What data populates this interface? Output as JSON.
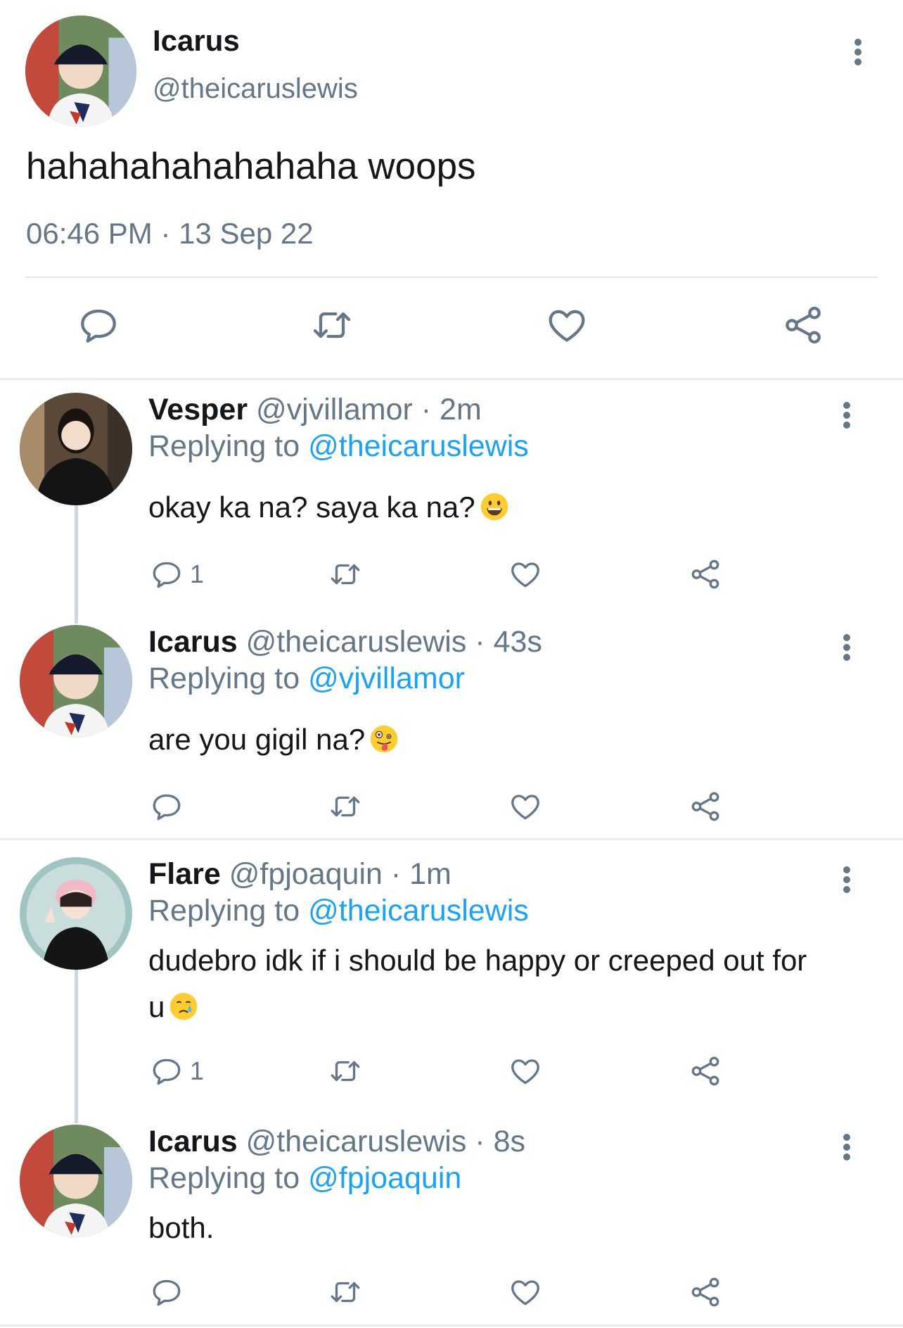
{
  "colors": {
    "text": "#14171a",
    "muted": "#657786",
    "link": "#1da1f2",
    "divider": "#e1e8ed",
    "thread_line": "#ccd6dd"
  },
  "main_tweet": {
    "name": "Icarus",
    "handle": "@theicaruslewis",
    "text": "hahahahahahahaha woops",
    "timestamp": "06:46 PM · 13 Sep 22",
    "actions": [
      "reply-icon",
      "retweet-icon",
      "like-icon",
      "share-icon"
    ]
  },
  "replies": [
    {
      "name": "Vesper",
      "meta": "@vjvillamor · 2m",
      "replying_label": "Replying to",
      "replying_to": "@theicaruslewis",
      "text": "okay ka na? saya ka na?",
      "emoji": "grinning-face-emoji",
      "reply_count": "1"
    },
    {
      "name": "Icarus",
      "meta": "@theicaruslewis · 43s",
      "replying_label": "Replying to",
      "replying_to": "@vjvillamor",
      "text": "are you gigil na?",
      "emoji": "zany-face-emoji",
      "reply_count": ""
    },
    {
      "name": "Flare",
      "meta": "@fpjoaquin · 1m",
      "replying_label": "Replying to",
      "replying_to": "@theicaruslewis",
      "text": "dudebro idk if i should be happy or creeped out for u",
      "emoji": "crying-face-emoji",
      "reply_count": "1"
    },
    {
      "name": "Icarus",
      "meta": "@theicaruslewis · 8s",
      "replying_label": "Replying to",
      "replying_to": "@fpjoaquin",
      "text": "both.",
      "emoji": "",
      "reply_count": ""
    }
  ]
}
